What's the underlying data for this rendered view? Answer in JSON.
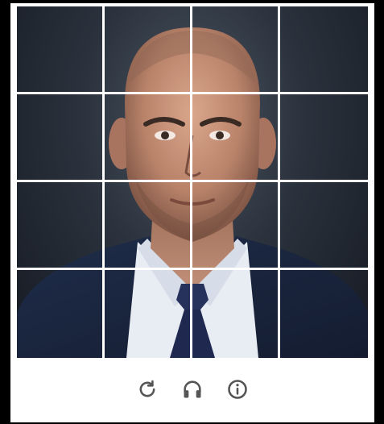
{
  "captcha": {
    "grid": {
      "rows": 4,
      "cols": 4
    },
    "controls": [
      {
        "name": "reload-button",
        "icon": "reload-icon"
      },
      {
        "name": "audio-challenge-button",
        "icon": "headphones-icon"
      },
      {
        "name": "info-button",
        "icon": "info-icon"
      }
    ],
    "colors": {
      "frame": "#000000",
      "panel": "#ffffff",
      "grid_lines": "#ffffff",
      "icons": "#555555",
      "suit": "#1c2a44",
      "shirt": "#e8ecf3",
      "tie": "#232d55"
    }
  }
}
